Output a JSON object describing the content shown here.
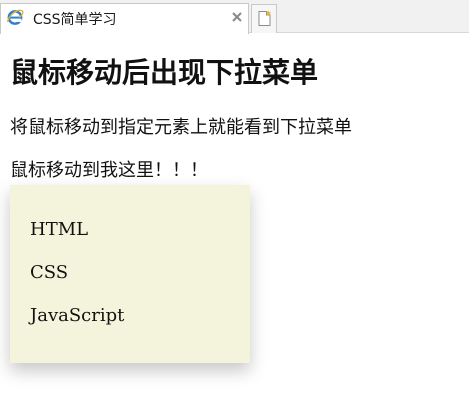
{
  "browser": {
    "tab": {
      "title": "CSS简单学习",
      "icon": "ie-logo-icon",
      "close_icon": "close-icon"
    },
    "new_tab_icon": "new-tab-icon"
  },
  "page": {
    "heading": "鼠标移动后出现下拉菜单",
    "intro": "将鼠标移动到指定元素上就能看到下拉菜单",
    "trigger": "鼠标移动到我这里！！！",
    "dropdown": {
      "items": [
        "HTML",
        "CSS",
        "JavaScript"
      ],
      "background": "#f4f4dc"
    }
  }
}
